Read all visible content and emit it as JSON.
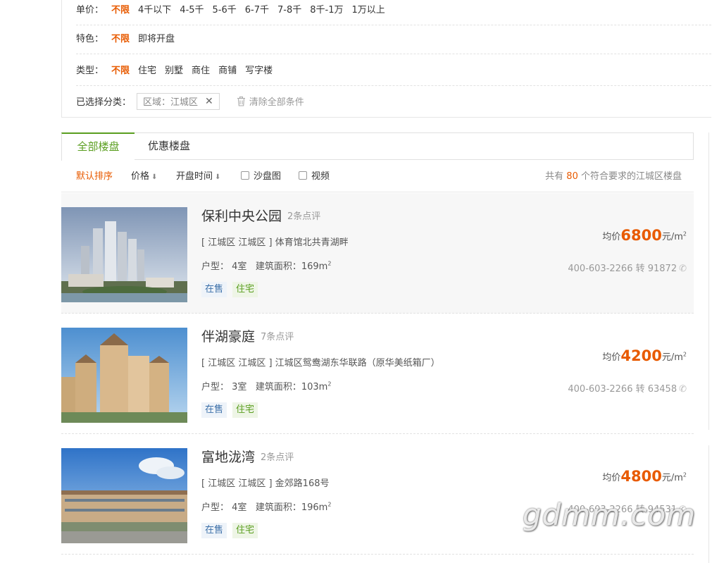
{
  "filters": {
    "unit_price": {
      "label": "单价：",
      "options": [
        "不限",
        "4千以下",
        "4-5千",
        "5-6千",
        "6-7千",
        "7-8千",
        "8千-1万",
        "1万以上"
      ]
    },
    "feature": {
      "label": "特色：",
      "options": [
        "不限",
        "即将开盘"
      ]
    },
    "type": {
      "label": "类型：",
      "options": [
        "不限",
        "住宅",
        "别墅",
        "商住",
        "商铺",
        "写字楼"
      ]
    },
    "selected": {
      "label": "已选择分类：",
      "tag": "区域：江城区",
      "tag_close": "✕",
      "clear_all": "清除全部条件"
    }
  },
  "tabs": [
    "全部楼盘",
    "优惠楼盘"
  ],
  "sortbar": {
    "default_sort": "默认排序",
    "price": "价格",
    "open_time": "开盘时间",
    "sand_table": "沙盘图",
    "video": "视频",
    "arrow": "⬇",
    "count_prefix": "共有",
    "count": "80",
    "count_suffix": "个符合要求的江城区楼盘"
  },
  "listings": [
    {
      "name": "保利中央公园",
      "reviews": "2条点评",
      "address": "[ 江城区 江城区 ] 体育馆北共青湖畔",
      "layout_label": "户型：",
      "layout": "4室",
      "area_label": "建筑面积：",
      "area": "169m",
      "area_sup": "2",
      "tag_status": "在售",
      "tag_type": "住宅",
      "price_label": "均价",
      "price": "6800",
      "price_unit": "元/m",
      "price_sup": "2",
      "phone": "400-603-2266 转 91872"
    },
    {
      "name": "伴湖豪庭",
      "reviews": "7条点评",
      "address": "[ 江城区 江城区 ] 江城区鸳鸯湖东华联路（原华美纸箱厂）",
      "layout_label": "户型：",
      "layout": "3室",
      "area_label": "建筑面积：",
      "area": "103m",
      "area_sup": "2",
      "tag_status": "在售",
      "tag_type": "住宅",
      "price_label": "均价",
      "price": "4200",
      "price_unit": "元/m",
      "price_sup": "2",
      "phone": "400-603-2266 转 63458"
    },
    {
      "name": "富地泷湾",
      "reviews": "2条点评",
      "address": "[ 江城区 江城区 ] 金郊路168号",
      "layout_label": "户型：",
      "layout": "4室",
      "area_label": "建筑面积：",
      "area": "196m",
      "area_sup": "2",
      "tag_status": "在售",
      "tag_type": "住宅",
      "price_label": "均价",
      "price": "4800",
      "price_unit": "元/m",
      "price_sup": "2",
      "phone": "400-603-2266 转 94531"
    }
  ],
  "watermark": "gdmm.com",
  "colors": {
    "accent_orange": "#e85a00",
    "accent_green": "#5a9e1f",
    "tag_blue": "#3b6fa8"
  }
}
